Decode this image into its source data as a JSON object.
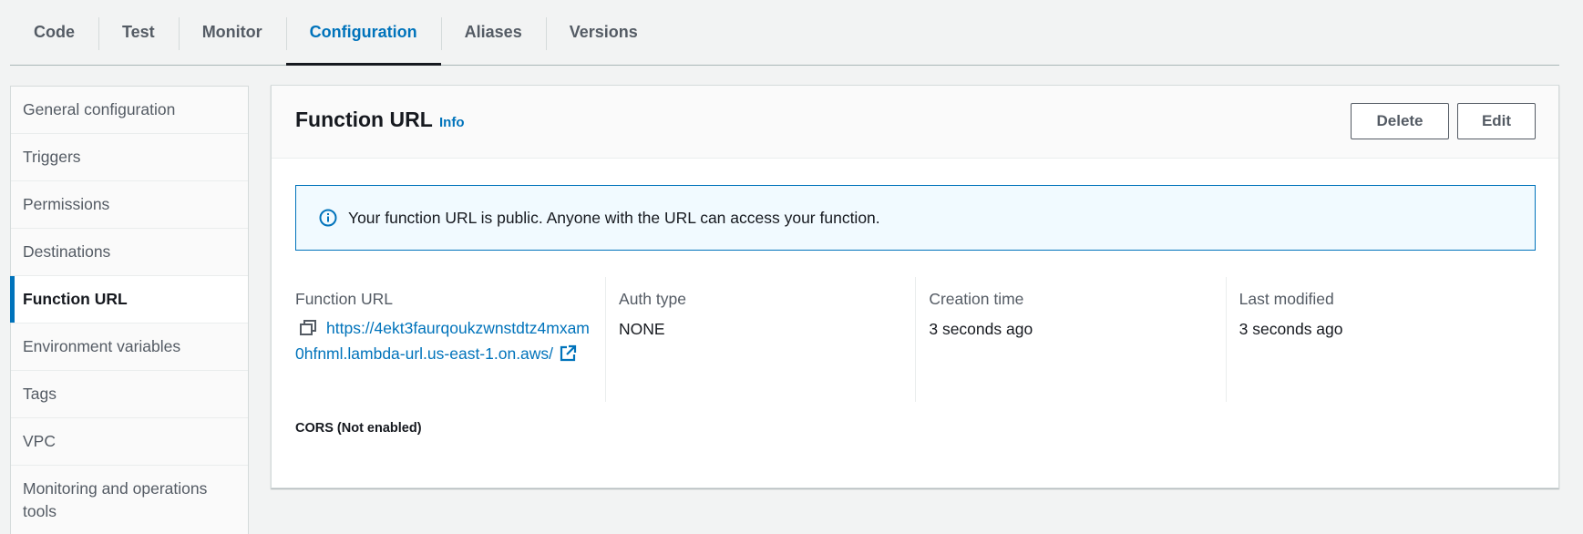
{
  "tabs": [
    {
      "label": "Code",
      "active": false
    },
    {
      "label": "Test",
      "active": false
    },
    {
      "label": "Monitor",
      "active": false
    },
    {
      "label": "Configuration",
      "active": true
    },
    {
      "label": "Aliases",
      "active": false
    },
    {
      "label": "Versions",
      "active": false
    }
  ],
  "sidebar": {
    "items": [
      {
        "label": "General configuration"
      },
      {
        "label": "Triggers"
      },
      {
        "label": "Permissions"
      },
      {
        "label": "Destinations"
      },
      {
        "label": "Function URL",
        "active": true
      },
      {
        "label": "Environment variables"
      },
      {
        "label": "Tags"
      },
      {
        "label": "VPC"
      },
      {
        "label": "Monitoring and operations tools"
      }
    ]
  },
  "panel": {
    "title": "Function URL",
    "info_label": "Info",
    "delete_label": "Delete",
    "edit_label": "Edit",
    "alert_text": "Your function URL is public. Anyone with the URL can access your function.",
    "details": {
      "function_url_label": "Function URL",
      "function_url_value": "https://4ekt3faurqoukzwnstdtz4mxam0hfnml.lambda-url.us-east-1.on.aws/",
      "auth_type_label": "Auth type",
      "auth_type_value": "NONE",
      "creation_time_label": "Creation time",
      "creation_time_value": "3 seconds ago",
      "last_modified_label": "Last modified",
      "last_modified_value": "3 seconds ago"
    },
    "cors_label": "CORS (Not enabled)"
  },
  "colors": {
    "accent": "#0073bb",
    "text": "#16191f",
    "muted": "#545b64",
    "alert_bg": "#f1faff"
  }
}
